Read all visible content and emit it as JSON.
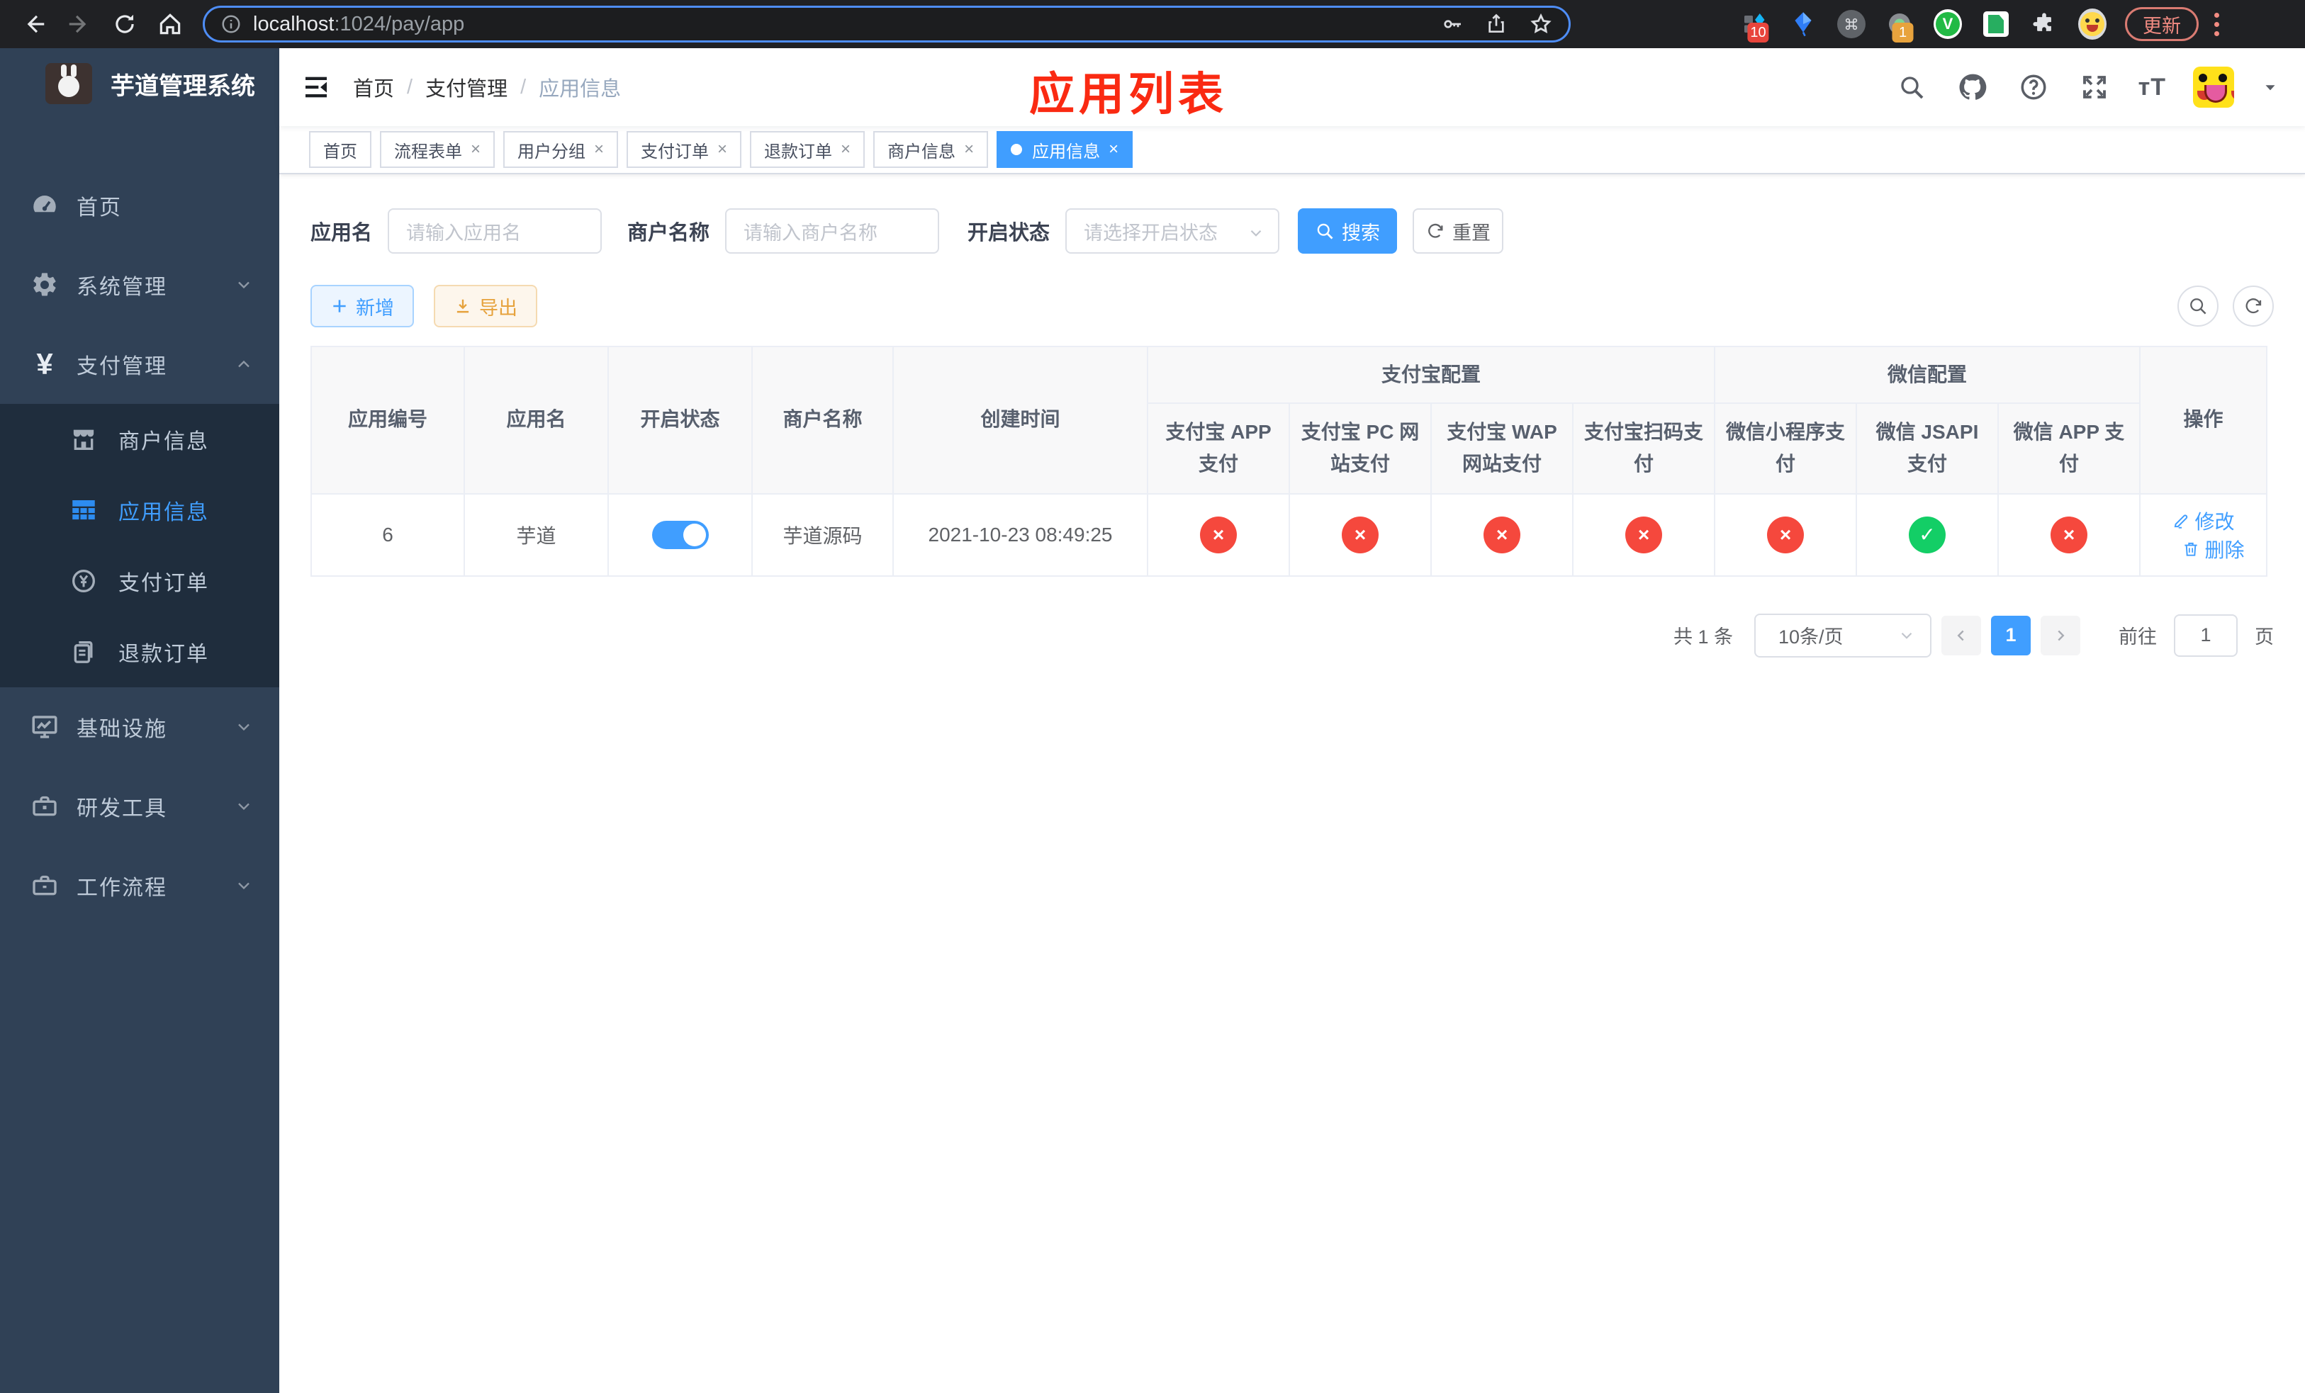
{
  "browser": {
    "url_host": "localhost",
    "url_rest": ":1024/pay/app",
    "update_label": "更新",
    "ext_badge_blue_diamond": "10",
    "ext_badge_recorder": "1",
    "vue_ext_letter": "V"
  },
  "sidebar": {
    "title": "芋道管理系统",
    "items": [
      {
        "label": "首页"
      },
      {
        "label": "系统管理"
      },
      {
        "label": "支付管理"
      },
      {
        "label": "商户信息"
      },
      {
        "label": "应用信息"
      },
      {
        "label": "支付订单"
      },
      {
        "label": "退款订单"
      },
      {
        "label": "基础设施"
      },
      {
        "label": "研发工具"
      },
      {
        "label": "工作流程"
      }
    ]
  },
  "breadcrumb": {
    "items": [
      "首页",
      "支付管理",
      "应用信息"
    ],
    "separator": "/"
  },
  "annotation": {
    "text": "应用列表"
  },
  "tabs": [
    {
      "label": "首页"
    },
    {
      "label": "流程表单"
    },
    {
      "label": "用户分组"
    },
    {
      "label": "支付订单"
    },
    {
      "label": "退款订单"
    },
    {
      "label": "商户信息"
    },
    {
      "label": "应用信息"
    }
  ],
  "search": {
    "app_name_label": "应用名",
    "app_name_placeholder": "请输入应用名",
    "merchant_label": "商户名称",
    "merchant_placeholder": "请输入商户名称",
    "status_label": "开启状态",
    "status_placeholder": "请选择开启状态",
    "search_label": "搜索",
    "reset_label": "重置"
  },
  "toolbar": {
    "add_label": "新增",
    "export_label": "导出"
  },
  "table": {
    "columns": [
      "应用编号",
      "应用名",
      "开启状态",
      "商户名称",
      "创建时间"
    ],
    "group_alipay": "支付宝配置",
    "group_wechat": "微信配置",
    "pay_columns": [
      "支付宝 APP 支付",
      "支付宝 PC 网站支付",
      "支付宝 WAP 网站支付",
      "支付宝扫码支付",
      "微信小程序支付",
      "微信 JSAPI 支付",
      "微信 APP 支付"
    ],
    "actions_column": "操作",
    "rows": [
      {
        "id": "6",
        "name": "芋道",
        "enabled": true,
        "merchant": "芋道源码",
        "created": "2021-10-23 08:49:25",
        "statuses": [
          false,
          false,
          false,
          false,
          false,
          true,
          false
        ],
        "edit_label": "修改",
        "delete_label": "删除"
      }
    ]
  },
  "pagination": {
    "total_text": "共 1 条",
    "page_size": "10条/页",
    "page": "1",
    "goto_label": "前往",
    "goto_value": "1",
    "page_unit": "页"
  },
  "colors": {
    "accent": "#409eff",
    "danger": "#f5483d",
    "success": "#13ce66",
    "annotation": "#fa2a12"
  }
}
